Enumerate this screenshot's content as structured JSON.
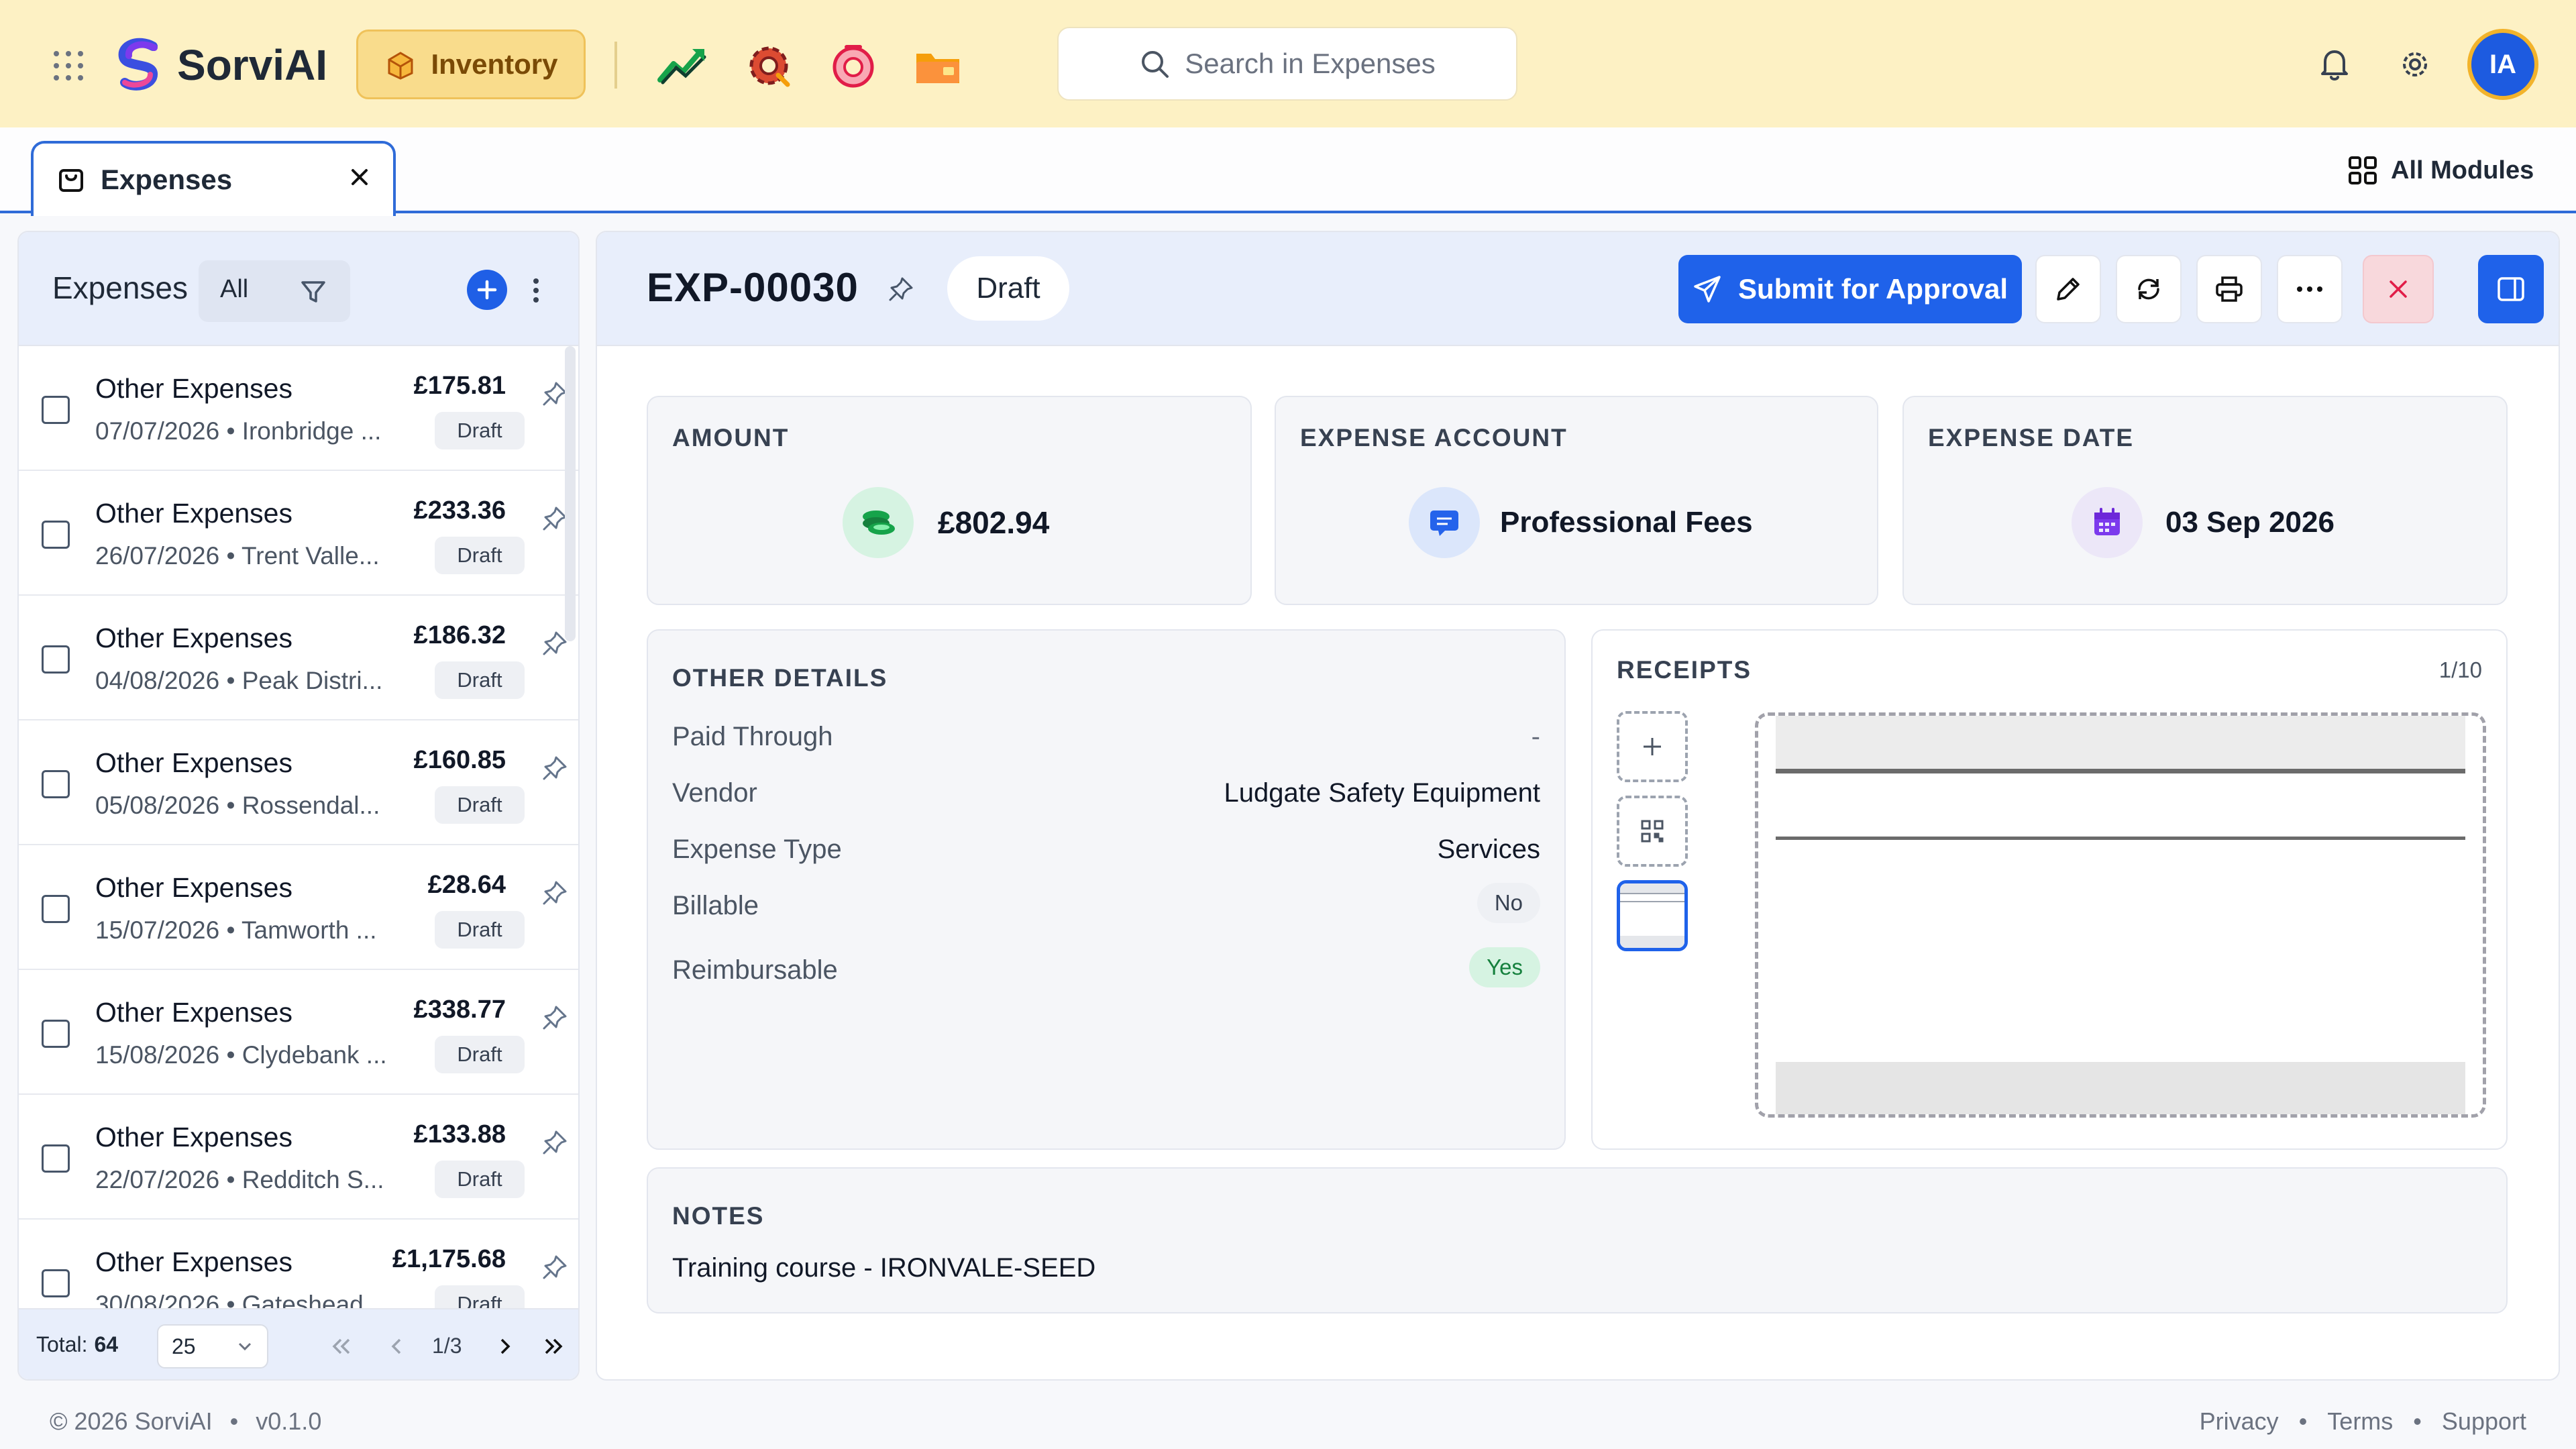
{
  "brand": {
    "name": "SorviAI"
  },
  "topbar": {
    "module_label": "Inventory",
    "search_placeholder": "Search in Expenses",
    "avatar_initials": "IA"
  },
  "tabs": {
    "active_tab": "Expenses",
    "all_modules_label": "All Modules"
  },
  "list": {
    "title": "Expenses",
    "filter_value": "All",
    "items": [
      {
        "name": "Other Expenses",
        "amount": "£175.81",
        "sub": "07/07/2026 • Ironbridge ...",
        "status": "Draft"
      },
      {
        "name": "Other Expenses",
        "amount": "£233.36",
        "sub": "26/07/2026 • Trent Valle...",
        "status": "Draft"
      },
      {
        "name": "Other Expenses",
        "amount": "£186.32",
        "sub": "04/08/2026 • Peak Distri...",
        "status": "Draft"
      },
      {
        "name": "Other Expenses",
        "amount": "£160.85",
        "sub": "05/08/2026 • Rossendal...",
        "status": "Draft"
      },
      {
        "name": "Other Expenses",
        "amount": "£28.64",
        "sub": "15/07/2026 • Tamworth ...",
        "status": "Draft"
      },
      {
        "name": "Other Expenses",
        "amount": "£338.77",
        "sub": "15/08/2026 • Clydebank ...",
        "status": "Draft"
      },
      {
        "name": "Other Expenses",
        "amount": "£133.88",
        "sub": "22/07/2026 • Redditch S...",
        "status": "Draft"
      },
      {
        "name": "Other Expenses",
        "amount": "£1,175.68",
        "sub": "30/08/2026 • Gateshead ...",
        "status": "Draft"
      }
    ],
    "footer": {
      "total_label": "Total:",
      "total_value": "64",
      "page_size": "25",
      "page_indicator": "1/3"
    }
  },
  "detail": {
    "id": "EXP-00030",
    "status": "Draft",
    "submit_label": "Submit for Approval",
    "amount": {
      "caption": "AMOUNT",
      "value": "£802.94"
    },
    "account": {
      "caption": "EXPENSE ACCOUNT",
      "value": "Professional Fees"
    },
    "date": {
      "caption": "EXPENSE DATE",
      "value": "03 Sep 2026"
    },
    "other_details": {
      "caption": "OTHER DETAILS",
      "paid_through_label": "Paid Through",
      "paid_through_value": "-",
      "vendor_label": "Vendor",
      "vendor_value": "Ludgate Safety Equipment",
      "type_label": "Expense Type",
      "type_value": "Services",
      "billable_label": "Billable",
      "billable_value": "No",
      "reimbursable_label": "Reimbursable",
      "reimbursable_value": "Yes"
    },
    "receipts": {
      "caption": "RECEIPTS",
      "count": "1/10"
    },
    "notes": {
      "caption": "NOTES",
      "text": "Training course - IRONVALE-SEED"
    }
  },
  "footer": {
    "copyright": "© 2026 SorviAI",
    "version": "v0.1.0",
    "links": [
      "Privacy",
      "Terms",
      "Support"
    ]
  },
  "colors": {
    "primary": "#1f62ea",
    "topbar_bg": "#fdf1c4",
    "success": "#16a34a",
    "danger_bg": "#f8d8dc"
  },
  "icons": {
    "topbar_apps": [
      "trend-chart-icon",
      "gear-cog-icon",
      "lifebuoy-icon",
      "folder-icon"
    ]
  }
}
